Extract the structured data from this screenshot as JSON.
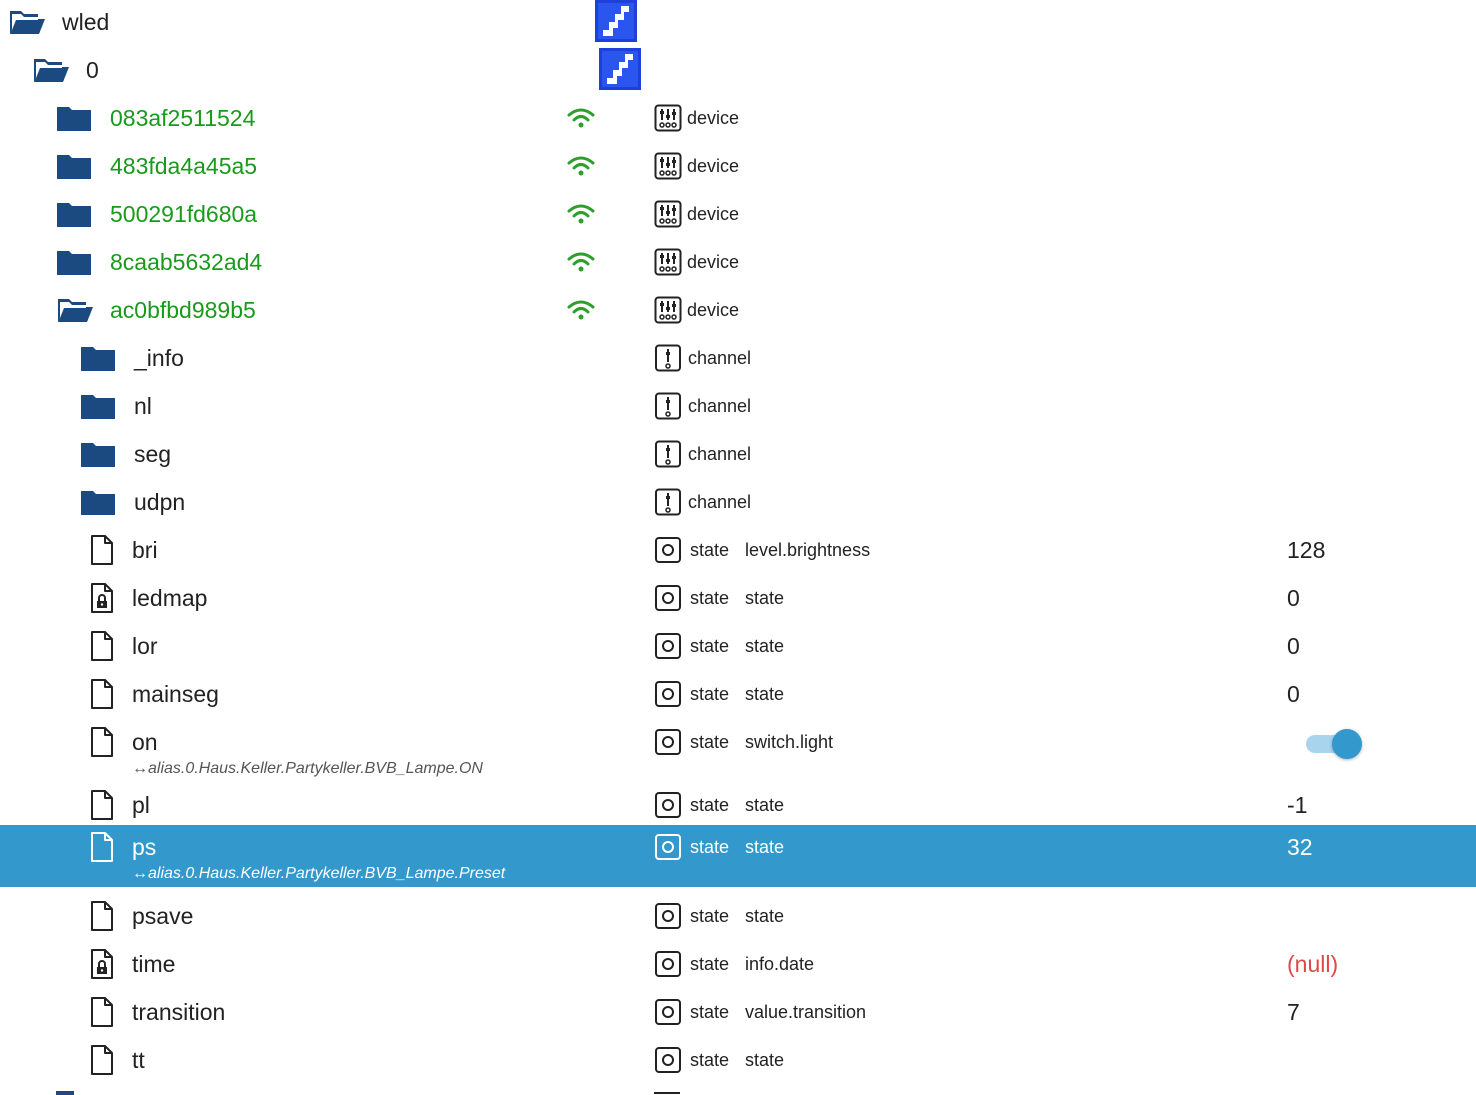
{
  "colors": {
    "folder": "#1a4a80",
    "green_text": "#1a9a1a",
    "selected_bg": "#3399cc",
    "null_value": "#e04848",
    "wifi": "#2aa12a"
  },
  "tree": {
    "root": {
      "name": "wled",
      "icon": "folder-open-icon"
    },
    "instance": {
      "name": "0",
      "icon": "folder-open-icon"
    },
    "devices": [
      {
        "name": "083af2511524",
        "type": "device"
      },
      {
        "name": "483fda4a45a5",
        "type": "device"
      },
      {
        "name": "500291fd680a",
        "type": "device"
      },
      {
        "name": "8caab5632ad4",
        "type": "device"
      },
      {
        "name": "ac0bfbd989b5",
        "type": "device"
      }
    ],
    "channels": [
      {
        "name": "_info",
        "type": "channel"
      },
      {
        "name": "nl",
        "type": "channel"
      },
      {
        "name": "seg",
        "type": "channel"
      },
      {
        "name": "udpn",
        "type": "channel"
      }
    ],
    "states": [
      {
        "name": "bri",
        "type": "state",
        "role": "level.brightness",
        "value": "128"
      },
      {
        "name": "ledmap",
        "type": "state",
        "role": "state",
        "value": "0",
        "locked": true
      },
      {
        "name": "lor",
        "type": "state",
        "role": "state",
        "value": "0"
      },
      {
        "name": "mainseg",
        "type": "state",
        "role": "state",
        "value": "0"
      },
      {
        "name": "on",
        "type": "state",
        "role": "switch.light",
        "alias": "↔alias.0.Haus.Keller.Partykeller.BVB_Lampe.ON",
        "toggle_on": true
      },
      {
        "name": "pl",
        "type": "state",
        "role": "state",
        "value": "-1"
      },
      {
        "name": "ps",
        "type": "state",
        "role": "state",
        "value": "32",
        "alias": "↔alias.0.Haus.Keller.Partykeller.BVB_Lampe.Preset",
        "selected": true
      },
      {
        "name": "psave",
        "type": "state",
        "role": "state",
        "value": ""
      },
      {
        "name": "time",
        "type": "state",
        "role": "info.date",
        "value": "(null)",
        "locked": true
      },
      {
        "name": "transition",
        "type": "state",
        "role": "value.transition",
        "value": "7"
      },
      {
        "name": "tt",
        "type": "state",
        "role": "state",
        "value": ""
      }
    ]
  }
}
